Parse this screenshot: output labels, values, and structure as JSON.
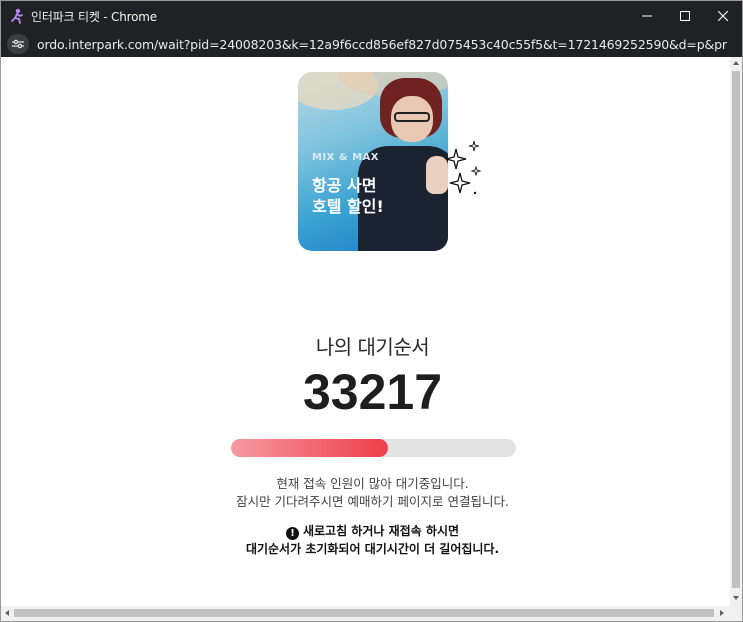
{
  "window": {
    "title": "인터파크 티켓 - Chrome",
    "url": "ordo.interpark.com/wait?pid=24008203&k=12a9f6ccd856ef827d075453c40c55f5&t=1721469252590&d=p&pmcode&genreCode&..."
  },
  "banner": {
    "subtitle": "MIX & MAX",
    "line1": "항공 사면",
    "line2": "호텔 할인!"
  },
  "queue": {
    "label": "나의 대기순서",
    "number": "33217",
    "progress_percent": 55
  },
  "info": {
    "line1": "현재 접속 인원이 많아 대기중입니다.",
    "line2": "잠시만 기다려주시면 예매하기 페이지로 연결됩니다."
  },
  "warning": {
    "icon": "exclamation-circle-icon",
    "line1": "새로고침 하거나 재접속 하시면",
    "line2": "대기순서가 초기화되어 대기시간이 더 길어집니다."
  },
  "colors": {
    "progress_start": "#f79aa0",
    "progress_end": "#ee3f4c",
    "track": "#e3e3e3"
  }
}
